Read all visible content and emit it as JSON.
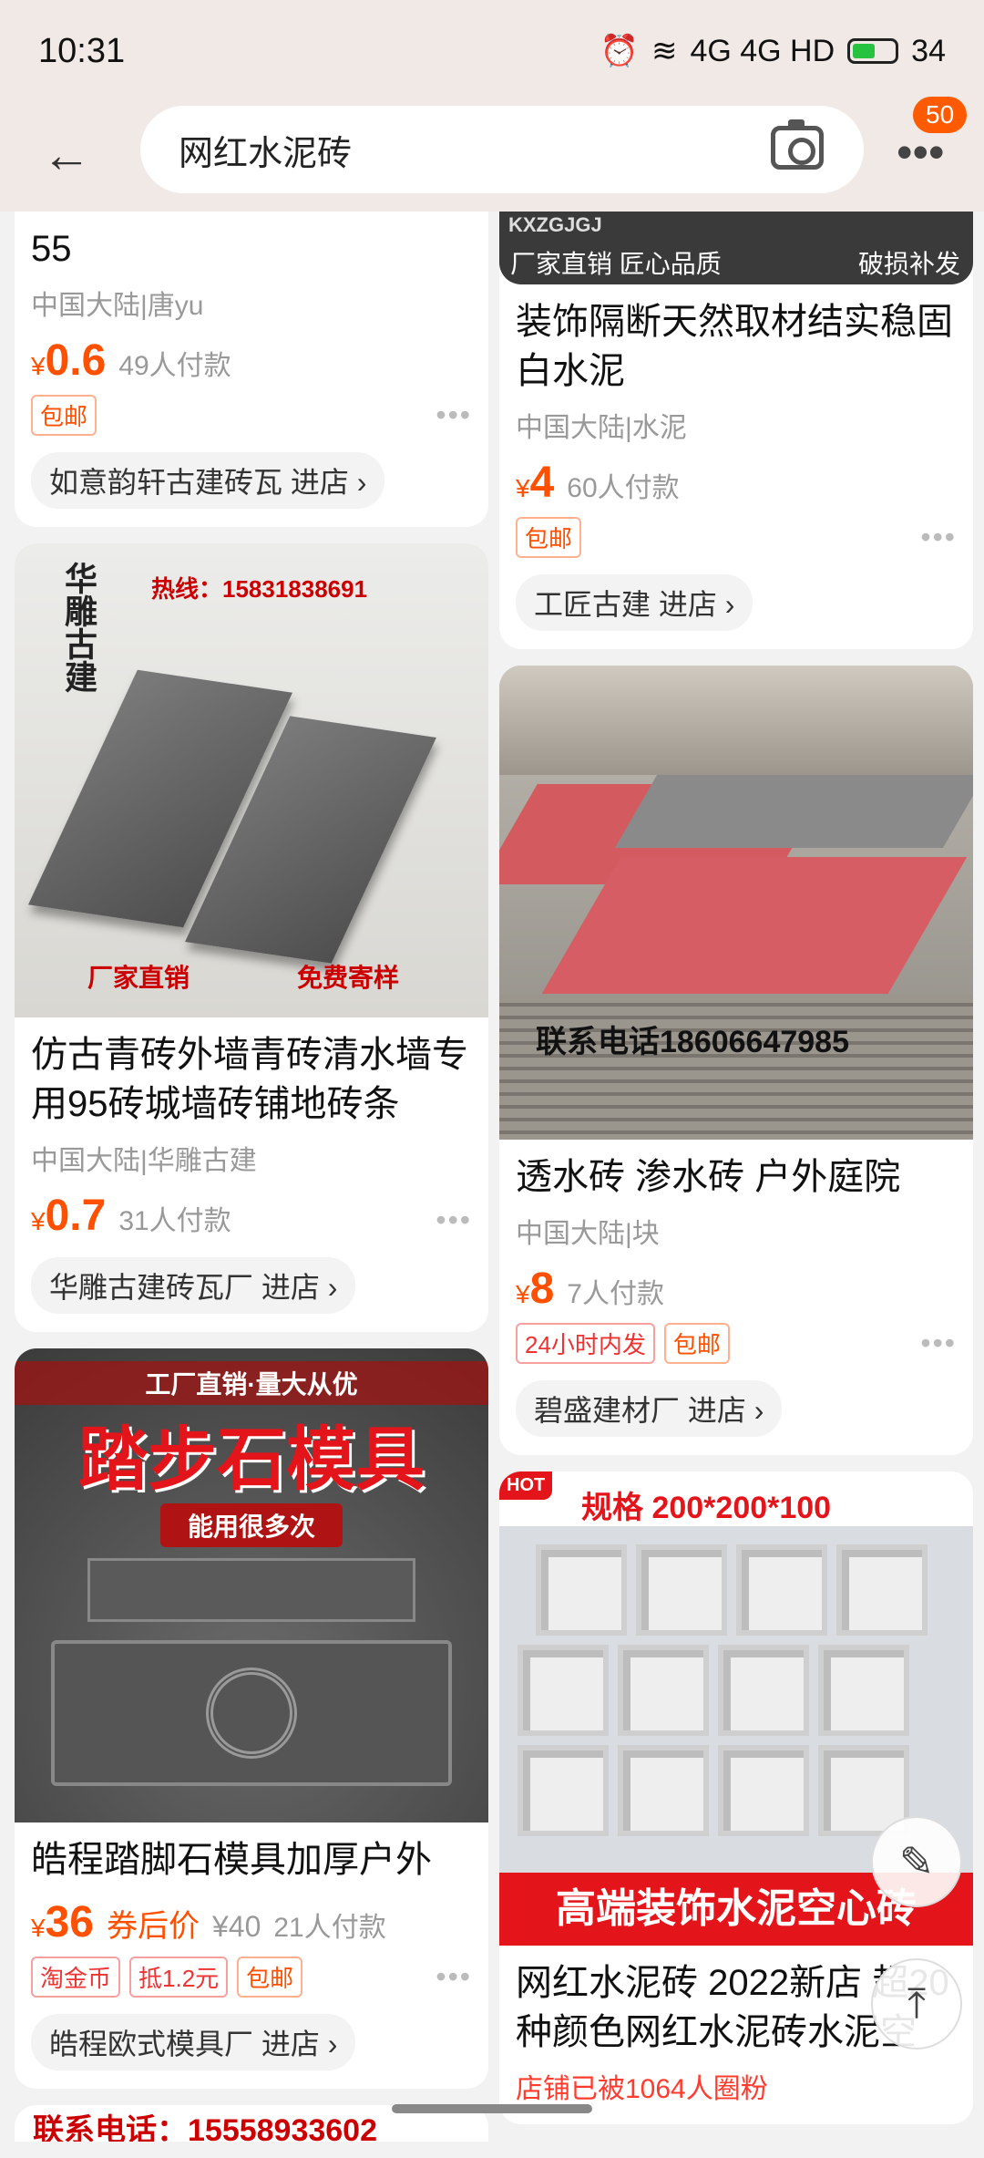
{
  "status": {
    "time": "10:31",
    "network": "4G 4G HD",
    "battery": "34"
  },
  "header": {
    "search_text": "网红水泥砖",
    "badge": "50"
  },
  "left": {
    "top_card": {
      "title": "55",
      "loc": "中国大陆|唐yu",
      "yen": "¥",
      "price": "0.6",
      "sold": "49人付款",
      "tag": "包邮",
      "dots": "•••",
      "store": "如意韵轩古建砖瓦 进店 ›"
    },
    "card2": {
      "img_hotline": "热线：15831838691",
      "img_brand": "华雕古建",
      "img_left": "厂家直销",
      "img_right": "免费寄样",
      "title": "仿古青砖外墙青砖清水墙专用95砖城墙砖铺地砖条",
      "loc": "中国大陆|华雕古建",
      "yen": "¥",
      "price": "0.7",
      "sold": "31人付款",
      "dots": "•••",
      "store": "华雕古建砖瓦厂 进店 ›"
    },
    "card3": {
      "img_top": "工厂直销·量大从优",
      "img_big": "踏步石模具",
      "img_sub": "能用很多次",
      "title": "皓程踏脚石模具加厚户外",
      "yen": "¥",
      "price": "36",
      "coupon": "券后价",
      "orig": "¥40",
      "sold": "21人付款",
      "tag1": "淘金币",
      "tag2": "抵1.2元",
      "tag3": "包邮",
      "dots": "•••",
      "store": "皓程欧式模具厂 进店 ›"
    },
    "card4": {
      "img_phone": "联系电话：15558933602"
    }
  },
  "right": {
    "top_card": {
      "img_code": "KXZGJGJ",
      "img_left": "厂家直销 匠心品质",
      "img_right": "破损补发",
      "title": "装饰隔断天然取材结实稳固白水泥",
      "loc": "中国大陆|水泥",
      "yen": "¥",
      "price": "4",
      "sold": "60人付款",
      "tag": "包邮",
      "dots": "•••",
      "store": "工匠古建 进店 ›"
    },
    "card2": {
      "img_phone": "联系电话18606647985",
      "title": "透水砖 渗水砖 户外庭院",
      "loc": "中国大陆|块",
      "yen": "¥",
      "price": "8",
      "sold": "7人付款",
      "tag1": "24小时内发",
      "tag2": "包邮",
      "dots": "•••",
      "store": "碧盛建材厂 进店 ›"
    },
    "card3": {
      "img_hot": "HOT",
      "img_spec": "规格 200*200*100",
      "img_bottom": "高端装饰水泥空心砖",
      "title": "网红水泥砖 2022新店 超20种颜色网红水泥砖水泥空",
      "fans": "店铺已被1064人圈粉"
    }
  },
  "fab": {
    "edit": "✎",
    "top": "⤒"
  }
}
